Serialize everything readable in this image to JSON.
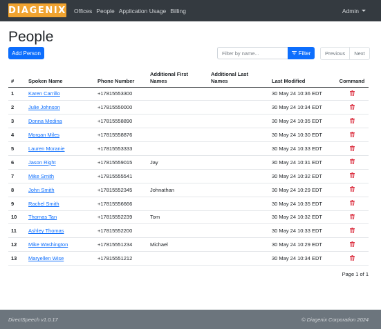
{
  "brand": {
    "logo_text": "DIAGENIX",
    "logo_color": "#f0a330"
  },
  "nav": {
    "items": [
      {
        "label": "Offices"
      },
      {
        "label": "People"
      },
      {
        "label": "Application Usage"
      },
      {
        "label": "Billing"
      }
    ],
    "user_menu": "Admin"
  },
  "page": {
    "title": "People"
  },
  "toolbar": {
    "add_label": "Add Person",
    "filter_placeholder": "Filter by name...",
    "filter_value": "",
    "filter_label": "Filter",
    "prev_label": "Previous",
    "next_label": "Next"
  },
  "table": {
    "headers": {
      "num": "#",
      "name": "Spoken Name",
      "phone": "Phone Number",
      "first": "Additional First Names",
      "last": "Additional Last Names",
      "modified": "Last Modified",
      "command": "Command"
    },
    "rows": [
      {
        "num": "1",
        "name": "Karen Carrillo",
        "phone": "+17815553300",
        "first": "",
        "last": "",
        "modified": "30 May 24 10:36 EDT"
      },
      {
        "num": "2",
        "name": "Julie Johnson",
        "phone": "+17815550000",
        "first": "",
        "last": "",
        "modified": "30 May 24 10:34 EDT"
      },
      {
        "num": "3",
        "name": "Donna Medina",
        "phone": "+17815558890",
        "first": "",
        "last": "",
        "modified": "30 May 24 10:35 EDT"
      },
      {
        "num": "4",
        "name": "Morgan Miles",
        "phone": "+17815558876",
        "first": "",
        "last": "",
        "modified": "30 May 24 10:30 EDT"
      },
      {
        "num": "5",
        "name": "Lauren Moranie",
        "phone": "+17815553333",
        "first": "",
        "last": "",
        "modified": "30 May 24 10:33 EDT"
      },
      {
        "num": "6",
        "name": "Jason Right",
        "phone": "+17815559015",
        "first": "Jay",
        "last": "",
        "modified": "30 May 24 10:31 EDT"
      },
      {
        "num": "7",
        "name": "Mike Smith",
        "phone": "+17815555541",
        "first": "",
        "last": "",
        "modified": "30 May 24 10:32 EDT"
      },
      {
        "num": "8",
        "name": "John Smith",
        "phone": "+17815552345",
        "first": "Johnathan",
        "last": "",
        "modified": "30 May 24 10:29 EDT"
      },
      {
        "num": "9",
        "name": "Rachel Smith",
        "phone": "+17815556666",
        "first": "",
        "last": "",
        "modified": "30 May 24 10:35 EDT"
      },
      {
        "num": "10",
        "name": "Thomas Tan",
        "phone": "+17815552239",
        "first": "Tom",
        "last": "",
        "modified": "30 May 24 10:32 EDT"
      },
      {
        "num": "11",
        "name": "Ashley Thomas",
        "phone": "+17815552200",
        "first": "",
        "last": "",
        "modified": "30 May 24 10:33 EDT"
      },
      {
        "num": "12",
        "name": "Mike Washington",
        "phone": "+17815551234",
        "first": "Michael",
        "last": "",
        "modified": "30 May 24 10:29 EDT"
      },
      {
        "num": "13",
        "name": "Maryellen Wise",
        "phone": "+17815551212",
        "first": "",
        "last": "",
        "modified": "30 May 24 10:34 EDT"
      }
    ],
    "delete_icon": "trash-icon",
    "delete_color": "#dc3545"
  },
  "pagination": {
    "summary": "Page 1 of 1"
  },
  "footer": {
    "version": "DirectSpeech v1.0.17",
    "copyright": "© Diagenix Corporation 2024"
  },
  "colors": {
    "primary": "#0d6efd",
    "navbar": "#343a40",
    "footer": "#6c757d",
    "danger": "#dc3545"
  }
}
